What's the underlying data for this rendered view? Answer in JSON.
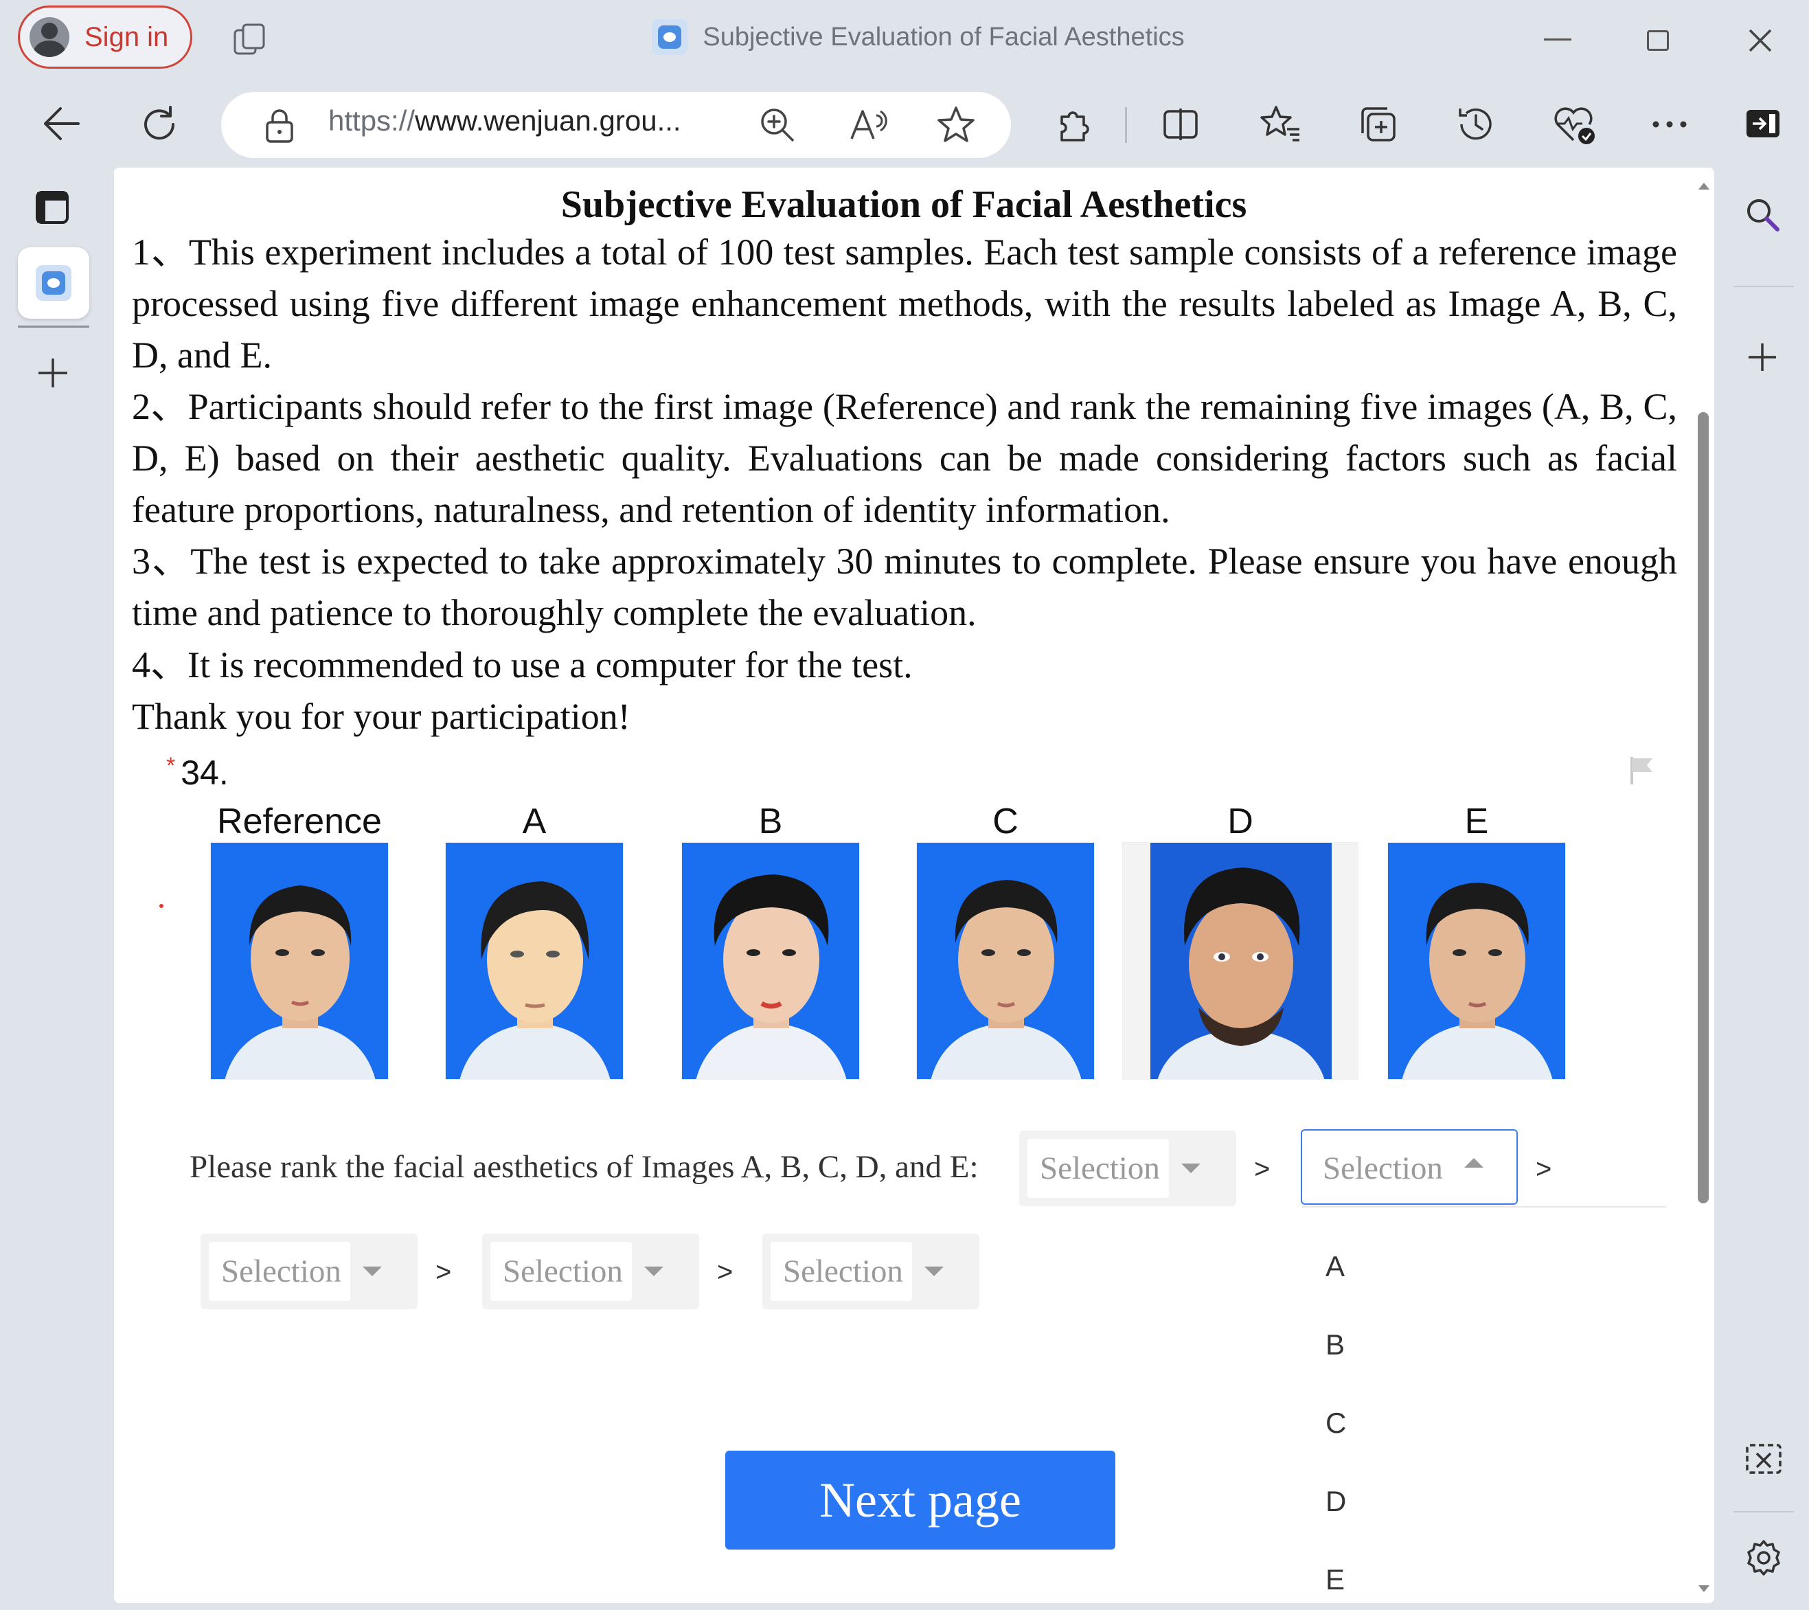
{
  "browser": {
    "sign_in_label": "Sign in",
    "window_title": "Subjective Evaluation of Facial Aesthetics",
    "url_protocol": "https://",
    "url_host": "www.wenjuan.grou...",
    "icons": [
      "workspaces-icon",
      "back-icon",
      "refresh-icon",
      "lock-icon",
      "zoom-icon",
      "read-aloud-icon",
      "favorite-star-icon",
      "extensions-icon",
      "split-screen-icon",
      "favorites-icon",
      "collections-icon",
      "history-icon",
      "browser-essentials-icon",
      "more-icon",
      "sidebar-toggle-icon",
      "minimize-icon",
      "maximize-icon",
      "close-icon",
      "tab-actions-icon",
      "new-tab-icon",
      "search-icon",
      "add-icon",
      "screenshot-icon",
      "settings-icon"
    ]
  },
  "survey": {
    "title": "Subjective Evaluation of Facial Aesthetics",
    "paragraphs": [
      "1、This experiment includes a total of 100 test samples. Each test sample consists of a reference image processed using five different image enhancement methods, with the results labeled as Image A, B, C, D, and E.",
      "2、Participants should refer to the first image (Reference) and rank the remaining five images (A, B, C, D, E) based on their aesthetic quality. Evaluations can be made considering factors such as facial feature proportions, naturalness, and retention of identity information.",
      "3、The test is expected to take approximately 30 minutes to complete. Please ensure you have enough time and patience to thoroughly complete the evaluation.",
      "4、It is recommended to use a computer for the test.",
      "Thank you for your participation!"
    ],
    "question": {
      "required_mark": "*",
      "number": "34.",
      "image_labels": [
        "Reference",
        "A",
        "B",
        "C",
        "D",
        "E"
      ],
      "rank_prompt": "Please rank the facial aesthetics of Images A, B, C, D, and E:",
      "separator": ">",
      "selects": [
        {
          "placeholder": "Selection",
          "open": false
        },
        {
          "placeholder": "Selection",
          "open": true
        },
        {
          "placeholder": "Selection",
          "open": false
        },
        {
          "placeholder": "Selection",
          "open": false
        },
        {
          "placeholder": "Selection",
          "open": false
        }
      ],
      "dropdown_options": [
        "A",
        "B",
        "C",
        "D",
        "E"
      ]
    },
    "next_button": "Next page"
  },
  "colors": {
    "accent": "#2a77f6",
    "photo_background": "#1a6ef0",
    "required_star": "#e03a2f",
    "sign_in": "#c8392f"
  }
}
